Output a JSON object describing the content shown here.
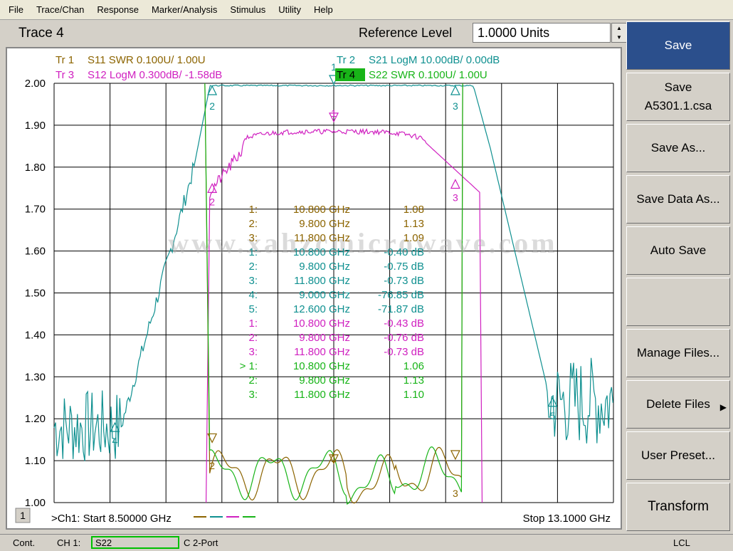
{
  "menu": [
    "File",
    "Trace/Chan",
    "Response",
    "Marker/Analysis",
    "Stimulus",
    "Utility",
    "Help"
  ],
  "toolbar": {
    "active_trace": "Trace 4",
    "ref_label": "Reference Level",
    "ref_value": "1.0000 Units"
  },
  "traces": [
    {
      "tag": "Tr  1",
      "text": "S11 SWR 0.100U/  1.00U",
      "color": "#8c6400"
    },
    {
      "tag": "Tr  2",
      "text": "S21 LogM 10.00dB/  0.00dB",
      "color": "#0f9090"
    },
    {
      "tag": "Tr  3",
      "text": "S12 LogM 0.300dB/  -1.58dB",
      "color": "#d020c0"
    },
    {
      "tag": "Tr  4",
      "text": "S22 SWR 0.100U/  1.00U",
      "color": "#18b418"
    }
  ],
  "watermark": "www.xahzcmicrowave.com",
  "yticks": [
    "2.00",
    "1.90",
    "1.80",
    "1.70",
    "1.60",
    "1.50",
    "1.40",
    "1.30",
    "1.20",
    "1.10",
    "1.00"
  ],
  "markers": [
    {
      "idx": "1:",
      "freq": "10.800 GHz",
      "val": "1.08",
      "color": "#8c6400"
    },
    {
      "idx": "2:",
      "freq": "9.800 GHz",
      "val": "1.13",
      "color": "#8c6400"
    },
    {
      "idx": "3:",
      "freq": "11.800 GHz",
      "val": "1.09",
      "color": "#8c6400"
    },
    {
      "idx": "1:",
      "freq": "10.800 GHz",
      "val": "-0.40 dB",
      "color": "#0f9090"
    },
    {
      "idx": "2:",
      "freq": "9.800 GHz",
      "val": "-0.75 dB",
      "color": "#0f9090"
    },
    {
      "idx": "3:",
      "freq": "11.800 GHz",
      "val": "-0.73 dB",
      "color": "#0f9090"
    },
    {
      "idx": "4:",
      "freq": "9.000 GHz",
      "val": "-76.85 dB",
      "color": "#0f9090"
    },
    {
      "idx": "5:",
      "freq": "12.600 GHz",
      "val": "-71.87 dB",
      "color": "#0f9090"
    },
    {
      "idx": "1:",
      "freq": "10.800 GHz",
      "val": "-0.43 dB",
      "color": "#d020c0"
    },
    {
      "idx": "2:",
      "freq": "9.800 GHz",
      "val": "-0.76 dB",
      "color": "#d020c0"
    },
    {
      "idx": "3:",
      "freq": "11.800 GHz",
      "val": "-0.73 dB",
      "color": "#d020c0"
    },
    {
      "idx": "> 1:",
      "freq": "10.800 GHz",
      "val": "1.06",
      "color": "#18b418"
    },
    {
      "idx": "2:",
      "freq": "9.800 GHz",
      "val": "1.13",
      "color": "#18b418"
    },
    {
      "idx": "3:",
      "freq": "11.800 GHz",
      "val": "1.10",
      "color": "#18b418"
    }
  ],
  "footer": {
    "channel_no": "1",
    "start": ">Ch1: Start  8.50000 GHz",
    "stop": "Stop  13.1000 GHz"
  },
  "softkeys": [
    {
      "line1": "Save",
      "line2": ""
    },
    {
      "line1": "Save",
      "line2": "A5301.1.csa"
    },
    {
      "line1": "Save As...",
      "line2": ""
    },
    {
      "line1": "Save Data As...",
      "line2": ""
    },
    {
      "line1": "Auto Save",
      "line2": ""
    },
    {
      "line1": "",
      "line2": ""
    },
    {
      "line1": "Manage Files...",
      "line2": ""
    },
    {
      "line1": "Delete Files",
      "line2": ""
    },
    {
      "line1": "User Preset...",
      "line2": ""
    },
    {
      "line1": "Transform",
      "line2": ""
    }
  ],
  "status": {
    "mode": "Cont.",
    "channel": "CH 1:",
    "param": "S22",
    "cal": "C  2-Port",
    "remote": "LCL"
  },
  "chart_data": {
    "type": "line",
    "xlabel": "",
    "ylabel": "",
    "xlim": [
      8.5,
      13.1
    ],
    "ylim": [
      1.0,
      2.0
    ],
    "grid": true,
    "series": [
      {
        "name": "Tr 1 S11 SWR",
        "x": [
          9.8,
          10.8,
          11.8
        ],
        "y": [
          1.13,
          1.08,
          1.09
        ]
      },
      {
        "name": "Tr 2 S21 LogM",
        "x": [
          9.0,
          9.8,
          10.8,
          11.8,
          12.6
        ],
        "y": [
          -76.85,
          -0.75,
          -0.4,
          -0.73,
          -71.87
        ]
      },
      {
        "name": "Tr 3 S12 LogM",
        "x": [
          9.8,
          10.8,
          11.8
        ],
        "y": [
          -0.76,
          -0.43,
          -0.73
        ]
      },
      {
        "name": "Tr 4 S22 SWR",
        "x": [
          9.8,
          10.8,
          11.8
        ],
        "y": [
          1.13,
          1.06,
          1.1
        ]
      }
    ]
  }
}
